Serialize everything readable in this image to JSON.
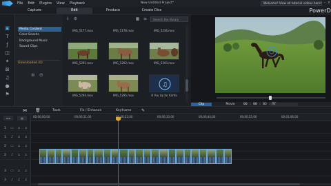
{
  "window": {
    "menu": [
      "File",
      "Edit",
      "Plugins",
      "View",
      "Playback"
    ],
    "project_title": "New Untitled Project*",
    "welcome": "Welcome! View all tutorial videos here!",
    "brand": "PowerD"
  },
  "modes": [
    "Capture",
    "Edit",
    "Produce",
    "Create Disc"
  ],
  "library": {
    "categories": [
      "Media Content",
      "Color Boards",
      "Background Music",
      "Sound Clips"
    ],
    "downloaded": "Downloaded (0)",
    "search_placeholder": "Search the library",
    "row_labels_top": [
      "IMG_5177.mov",
      "IMG_5178.mov",
      "IMG_5236.mov"
    ],
    "items": [
      {
        "label": "IMG_5291.mov"
      },
      {
        "label": "IMG_5292.mov"
      },
      {
        "label": "IMG_5293.mov"
      },
      {
        "label": "IMG_5294.mov"
      },
      {
        "label": "IMG_5295.mov"
      },
      {
        "label": "R You Up for Kimfa"
      }
    ]
  },
  "preview": {
    "tabs": [
      "Clip",
      "Movie"
    ],
    "timecode": "00 : 00 : 03 : 19",
    "fit": "Fit"
  },
  "edit_toolbar": {
    "tools": "Tools",
    "fix": "Fix / Enhance",
    "keyframe": "Keyframe"
  },
  "timeline": {
    "ruler": [
      "00;00;00;00",
      "00;00;11;00",
      "00;00;22;00",
      "00;00;33;00",
      "00;00;44;00",
      "00;00;55;00",
      "00;01;06;00"
    ],
    "tracks": [
      "1",
      "1",
      "2",
      "2",
      "3",
      "3"
    ]
  }
}
